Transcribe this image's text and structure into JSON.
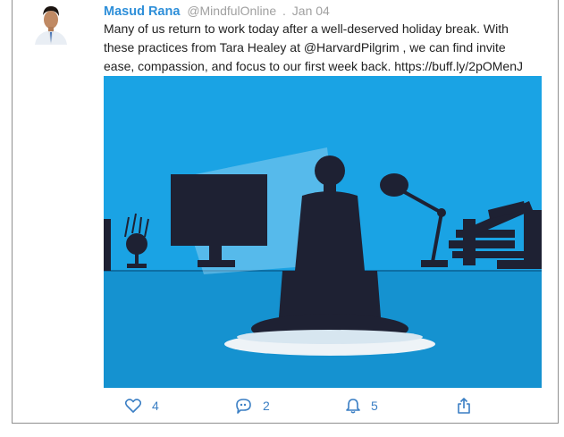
{
  "tweet": {
    "author_name": "Masud Rana",
    "handle": "@MindfulOnline",
    "separator": ".",
    "date": "Jan 04",
    "text_lines": [
      "Many of us return to work today after a well-deserved holiday break. With",
      "these practices from Tara Healey at @HarvardPilgrim , we can find invite",
      "ease, compassion, and focus to our first week back. https://buff.ly/2pOMenJ"
    ]
  },
  "actions": {
    "like_count": "4",
    "reply_count": "2",
    "notify_count": "5"
  },
  "icons": {
    "like": "heart-icon",
    "reply": "speech-bubble-icon",
    "notify": "bell-icon",
    "share": "share-icon"
  },
  "colors": {
    "name": "#2e8fd9",
    "meta": "#a0a0a0",
    "icon": "#3b7fc4",
    "illustration_blue": "#1aa3e4",
    "silhouette": "#1e2133"
  }
}
